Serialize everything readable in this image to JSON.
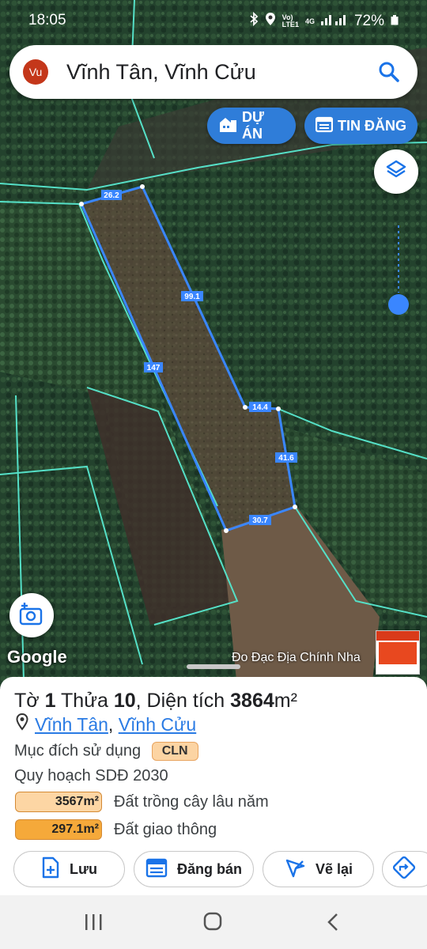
{
  "status_bar": {
    "time": "18:05",
    "network_line1": "Vo)",
    "network_line2": "LTE1",
    "network_type": "4G",
    "battery": "72%"
  },
  "search": {
    "avatar_text": "Vu",
    "title": "Vĩnh Tân, Vĩnh Cửu",
    "search_icon": "search-icon"
  },
  "top_buttons": {
    "project_label": "DỰ ÁN",
    "listing_label": "TIN ĐĂNG"
  },
  "map": {
    "edge_labels": [
      "26.2",
      "99.1",
      "147",
      "14.4",
      "41.6",
      "30.7"
    ],
    "google_label": "Google",
    "attribution": "Đo Đạc Địa Chính Nha",
    "parcel_color": "#3a86ff",
    "boundary_color": "#55e0c7"
  },
  "parcel": {
    "prefix_to": "Tờ",
    "to_number": "1",
    "prefix_thua": "Thửa",
    "thua_number": "10",
    "prefix_area": ", Diện tích",
    "area_value": "3864",
    "area_unit": "m²",
    "location_part1": "Vĩnh Tân",
    "location_sep": ",",
    "location_part2": "Vĩnh Cửu",
    "purpose_label": "Mục đích sử dụng",
    "purpose_code": "CLN",
    "plan_label": "Quy hoạch SDĐ 2030",
    "zones": [
      {
        "area": "3567m²",
        "label": "Đất trồng cây lâu năm",
        "color": "#fdd6a4",
        "fraction": 0.923
      },
      {
        "area": "297.1m²",
        "label": "Đất giao thông",
        "color": "#f5a93a",
        "fraction": 0.077
      }
    ]
  },
  "actions": [
    {
      "label": "Lưu",
      "icon": "add-file-icon"
    },
    {
      "label": "Đăng bán",
      "icon": "calendar-icon"
    },
    {
      "label": "Vẽ lại",
      "icon": "draw-icon"
    },
    {
      "label": "",
      "icon": "directions-icon"
    }
  ],
  "nav_icons": [
    "recents-icon",
    "home-icon",
    "back-icon"
  ]
}
